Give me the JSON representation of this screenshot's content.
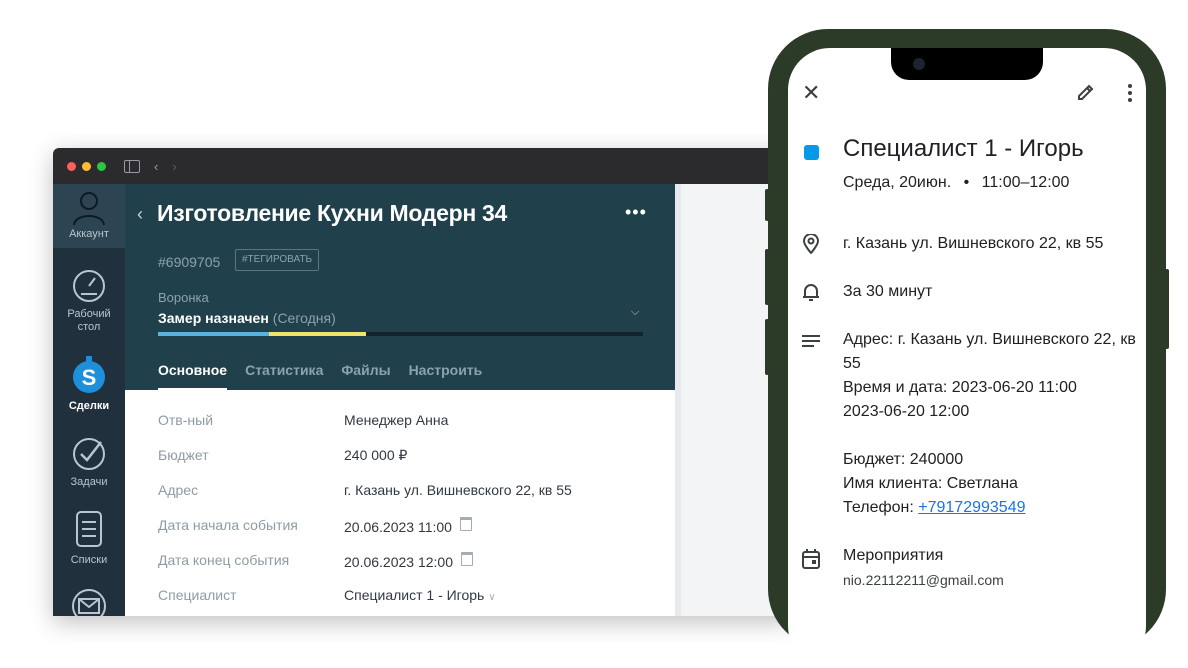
{
  "crm": {
    "sidebar": {
      "account": "Аккаунт",
      "dashboard_line1": "Рабочий",
      "dashboard_line2": "стол",
      "deals": "Сделки",
      "tasks": "Задачи",
      "lists": "Списки"
    },
    "lead": {
      "title": "Изготовление Кухни Модерн 34",
      "id": "#6909705",
      "tag_button": "#ТЕГИРОВАТЬ",
      "funnel_label": "Воронка",
      "stage": "Замер назначен",
      "stage_note": "(Сегодня)",
      "progress_colors": [
        "#5ab3de",
        "#f0e36a"
      ],
      "tabs": [
        "Основное",
        "Статистика",
        "Файлы",
        "Настроить"
      ],
      "fields": [
        {
          "label": "Отв-ный",
          "value": "Менеджер Анна"
        },
        {
          "label": "Бюджет",
          "value": "240 000 ₽"
        },
        {
          "label": "Адрес",
          "value": "г. Казань ул. Вишневского 22, кв 55"
        },
        {
          "label": "Дата начала события",
          "value": "20.06.2023 11:00"
        },
        {
          "label": "Дата конец события",
          "value": "20.06.2023 12:00"
        },
        {
          "label": "Специалист",
          "value": "Специалист 1 - Игорь"
        }
      ]
    }
  },
  "event": {
    "title": "Специалист 1 - Игорь",
    "day": "Среда, 20июн.",
    "separator": "•",
    "time": "11:00–12:00",
    "location": "г. Казань ул. Вишневского 22, кв 55",
    "reminder": "За 30 минут",
    "desc_address": "Адрес:  г. Казань ул. Вишневского 22, кв 55",
    "desc_datetime_label": "Время и дата: 2023-06-20 11:00",
    "desc_datetime_end": "2023-06-20 12:00",
    "desc_budget": "Бюджет: 240000",
    "desc_client": "Имя клиента:  Светлана",
    "desc_phone_label": "Телефон: ",
    "desc_phone": "+79172993549",
    "calendar_name": "Мероприятия",
    "calendar_email": "nio.22112211@gmail.com",
    "color": "#039be5"
  }
}
